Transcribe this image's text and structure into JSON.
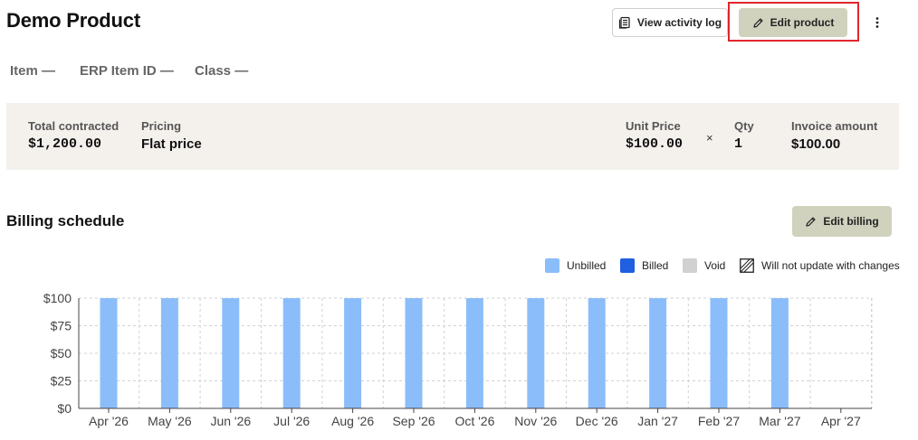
{
  "page": {
    "title": "Demo Product"
  },
  "header": {
    "activity_button": "View activity log",
    "edit_product_button": "Edit product"
  },
  "meta": {
    "item": "Item —",
    "erp": "ERP Item ID —",
    "class": "Class —"
  },
  "summary": {
    "total_contracted_label": "Total contracted",
    "total_contracted_value": "$1,200.00",
    "pricing_label": "Pricing",
    "pricing_value": "Flat price",
    "unit_price_label": "Unit Price",
    "unit_price_value": "$100.00",
    "times_symbol": "×",
    "qty_label": "Qty",
    "qty_value": "1",
    "invoice_label": "Invoice amount",
    "invoice_value": "$100.00"
  },
  "billing": {
    "title": "Billing schedule",
    "edit_button": "Edit billing"
  },
  "legend": {
    "unbilled": "Unbilled",
    "billed": "Billed",
    "void": "Void",
    "no_update": "Will not update with changes"
  },
  "colors": {
    "unbilled": "#8bbdfa",
    "billed": "#1f5fe0",
    "void": "#d1d1d1",
    "accent_button": "#d0d2be",
    "highlight": "#e0272b"
  },
  "chart_data": {
    "type": "bar",
    "categories": [
      "Apr '26",
      "May '26",
      "Jun '26",
      "Jul '26",
      "Aug '26",
      "Sep '26",
      "Oct '26",
      "Nov '26",
      "Dec '26",
      "Jan '27",
      "Feb '27",
      "Mar '27",
      "Apr '27"
    ],
    "series": [
      {
        "name": "Unbilled",
        "values": [
          100,
          100,
          100,
          100,
          100,
          100,
          100,
          100,
          100,
          100,
          100,
          100,
          0
        ]
      }
    ],
    "yticks": [
      "$0",
      "$25",
      "$50",
      "$75",
      "$100"
    ],
    "ytick_values": [
      0,
      25,
      50,
      75,
      100
    ],
    "ylim": [
      0,
      100
    ],
    "grid": true,
    "legend_position": "top-right",
    "title": "",
    "xlabel": "",
    "ylabel": ""
  }
}
